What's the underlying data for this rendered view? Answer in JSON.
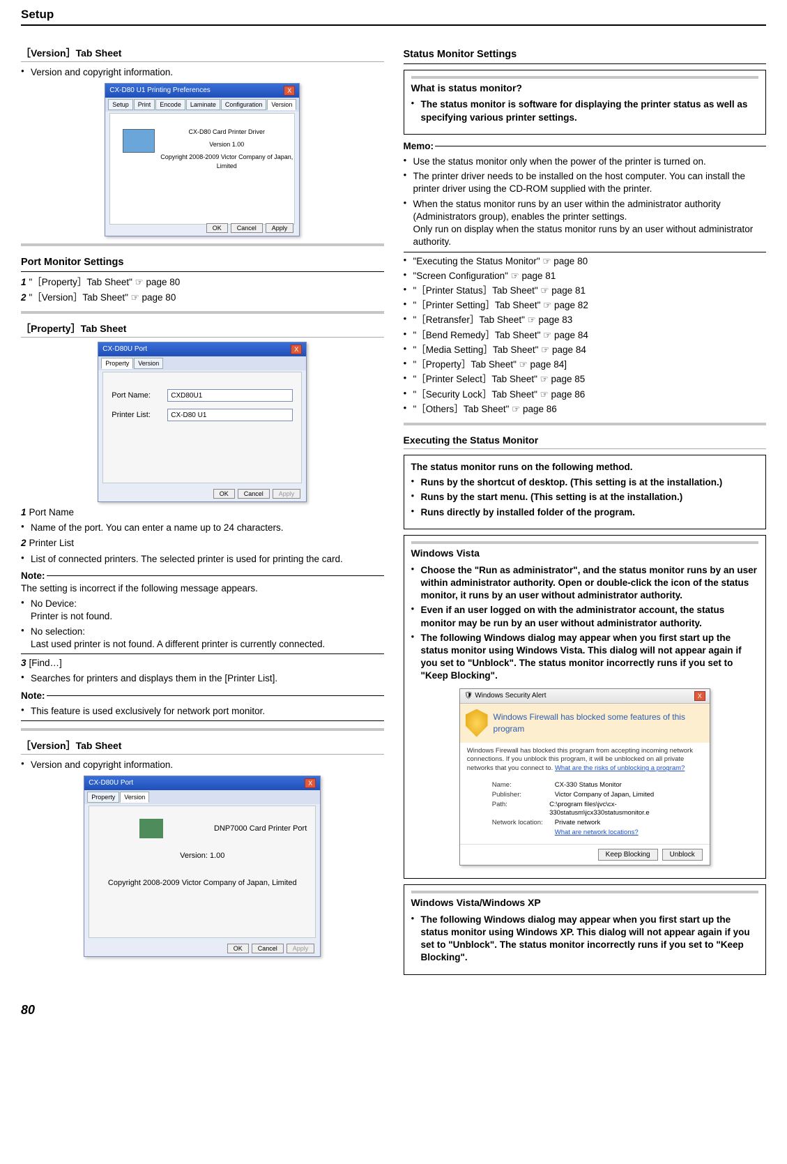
{
  "page": {
    "header": "Setup",
    "number": "80"
  },
  "left": {
    "version_tab": {
      "title": "［Version］Tab Sheet",
      "bullet": "Version and copyright information."
    },
    "ss_prefs": {
      "window_title": "CX-D80 U1 Printing Preferences",
      "tabs": [
        "Setup",
        "Print",
        "Encode",
        "Laminate",
        "Configuration",
        "Version"
      ],
      "line1": "CX-D80 Card Printer Driver",
      "line2": "Version 1.00",
      "line3": "Copyright 2008-2009 Victor Company of Japan, Limited",
      "btn_ok": "OK",
      "btn_cancel": "Cancel",
      "btn_apply": "Apply"
    },
    "port_monitor": {
      "title": "Port Monitor Settings",
      "items": [
        {
          "n": "1",
          "text": "\"［Property］Tab Sheet\" ☞ page 80"
        },
        {
          "n": "2",
          "text": "\"［Version］Tab Sheet\" ☞ page 80"
        }
      ]
    },
    "property_tab": {
      "title": "［Property］Tab Sheet"
    },
    "ss_port_prop": {
      "window_title": "CX-D80U Port",
      "tab_property": "Property",
      "tab_version": "Version",
      "label_port": "Port Name:",
      "val_port": "CXD80U1",
      "label_list": "Printer List:",
      "val_list": "CX-D80      U1",
      "btn_ok": "OK",
      "btn_cancel": "Cancel",
      "btn_apply": "Apply"
    },
    "prop_items": {
      "i1_n": "1",
      "i1_t": "Port Name",
      "i1_b": "Name of the port. You can enter a name up to 24 characters.",
      "i2_n": "2",
      "i2_t": "Printer List",
      "i2_b": "List of connected printers. The selected printer is used for printing the card.",
      "note_hd": "Note:",
      "note_txt": "The setting is incorrect if the following message appears.",
      "nb1a": "No Device:",
      "nb1b": "Printer is not found.",
      "nb2a": "No selection:",
      "nb2b": "Last used printer is not found. A different printer is currently connected.",
      "i3_n": "3",
      "i3_t": "[Find…]",
      "i3_b": "Searches for printers and displays them in the [Printer List].",
      "note2_hd": "Note:",
      "note2_b": "This feature is used exclusively for network port monitor."
    },
    "version_tab2": {
      "title": "［Version］Tab Sheet",
      "bullet": "Version and copyright information."
    },
    "ss_port_ver": {
      "window_title": "CX-D80U Port",
      "tab_property": "Property",
      "tab_version": "Version",
      "line1": "DNP7000 Card Printer Port",
      "line2": "Version: 1.00",
      "line3": "Copyright 2008-2009 Victor Company of Japan, Limited",
      "btn_ok": "OK",
      "btn_cancel": "Cancel",
      "btn_apply": "Apply"
    }
  },
  "right": {
    "status_settings": {
      "title": "Status Monitor Settings"
    },
    "what_box": {
      "title": "What is status monitor?",
      "bullet": "The status monitor is software for displaying the printer status as well as specifying various printer settings."
    },
    "memo": {
      "hd": "Memo:",
      "b1": "Use the status monitor only when the power of the printer is turned on.",
      "b2": "The printer driver needs to be installed on the host computer. You can install the printer driver using the CD-ROM supplied with the printer.",
      "b3a": "When the status monitor runs by an user within the administrator authority (Administrators group), enables the printer settings.",
      "b3b": "Only run on display when the status monitor runs by an user without administrator authority."
    },
    "links": [
      "\"Executing the Status Monitor\" ☞ page 80",
      "\"Screen Configuration\" ☞ page 81",
      "\"［Printer Status］Tab Sheet\" ☞ page 81",
      "\"［Printer Setting］Tab Sheet\" ☞ page 82",
      "\"［Retransfer］Tab Sheet\" ☞ page 83",
      "\"［Bend Remedy］Tab Sheet\" ☞ page 84",
      "\"［Media Setting］Tab Sheet\" ☞ page 84",
      "\"［Property］Tab Sheet\" ☞ page 84]",
      "\"［Printer Select］Tab Sheet\" ☞ page 85",
      "\"［Security Lock］Tab Sheet\" ☞ page 86",
      "\"［Others］Tab Sheet\" ☞ page 86"
    ],
    "exec": {
      "title": "Executing the Status Monitor",
      "box_lead": "The status monitor runs on the following method.",
      "b1": "Runs by the shortcut of desktop. (This setting is at the installation.)",
      "b2": "Runs by the start menu. (This setting is at the installation.)",
      "b3": "Runs directly by installed folder of the program."
    },
    "vista": {
      "title": "Windows Vista",
      "b1": "Choose the \"Run as administrator\", and the status monitor runs by an user within administrator authority. Open or double-click the icon of the status monitor, it runs by an user without administrator authority.",
      "b2": "Even if an user logged on with the administrator account, the status monitor may be run by an user without administrator authority.",
      "b3": "The following Windows dialog may appear when you first start up the status monitor using Windows Vista. This dialog will not appear again if you set to \"Unblock\". The status monitor incorrectly runs if you set to \"Keep Blocking\"."
    },
    "ss_alert": {
      "window_title": "Windows Security Alert",
      "hero": "Windows Firewall has blocked some features of this program",
      "desc": "Windows Firewall has blocked this program from accepting incoming network connections. If you unblock this program, it will be unblocked on all private networks that you connect to.",
      "risk": "What are the risks of unblocking a program?",
      "k_name": "Name:",
      "v_name": "CX-330 Status Monitor",
      "k_pub": "Publisher:",
      "v_pub": "Victor Company of Japan, Limited",
      "k_path": "Path:",
      "v_path": "C:\\program files\\jvc\\cx-330statusm\\jcx330statusmonitor.e",
      "k_net": "Network location:",
      "v_net": "Private network",
      "net_link": "What are network locations?",
      "btn_keep": "Keep Blocking",
      "btn_unblock": "Unblock"
    },
    "vistaxp": {
      "title": "Windows Vista/Windows XP",
      "b1": "The following Windows dialog may appear when you first start up the status monitor using Windows XP. This dialog will not appear again if you set to \"Unblock\". The status monitor incorrectly runs if you set to \"Keep Blocking\"."
    }
  }
}
